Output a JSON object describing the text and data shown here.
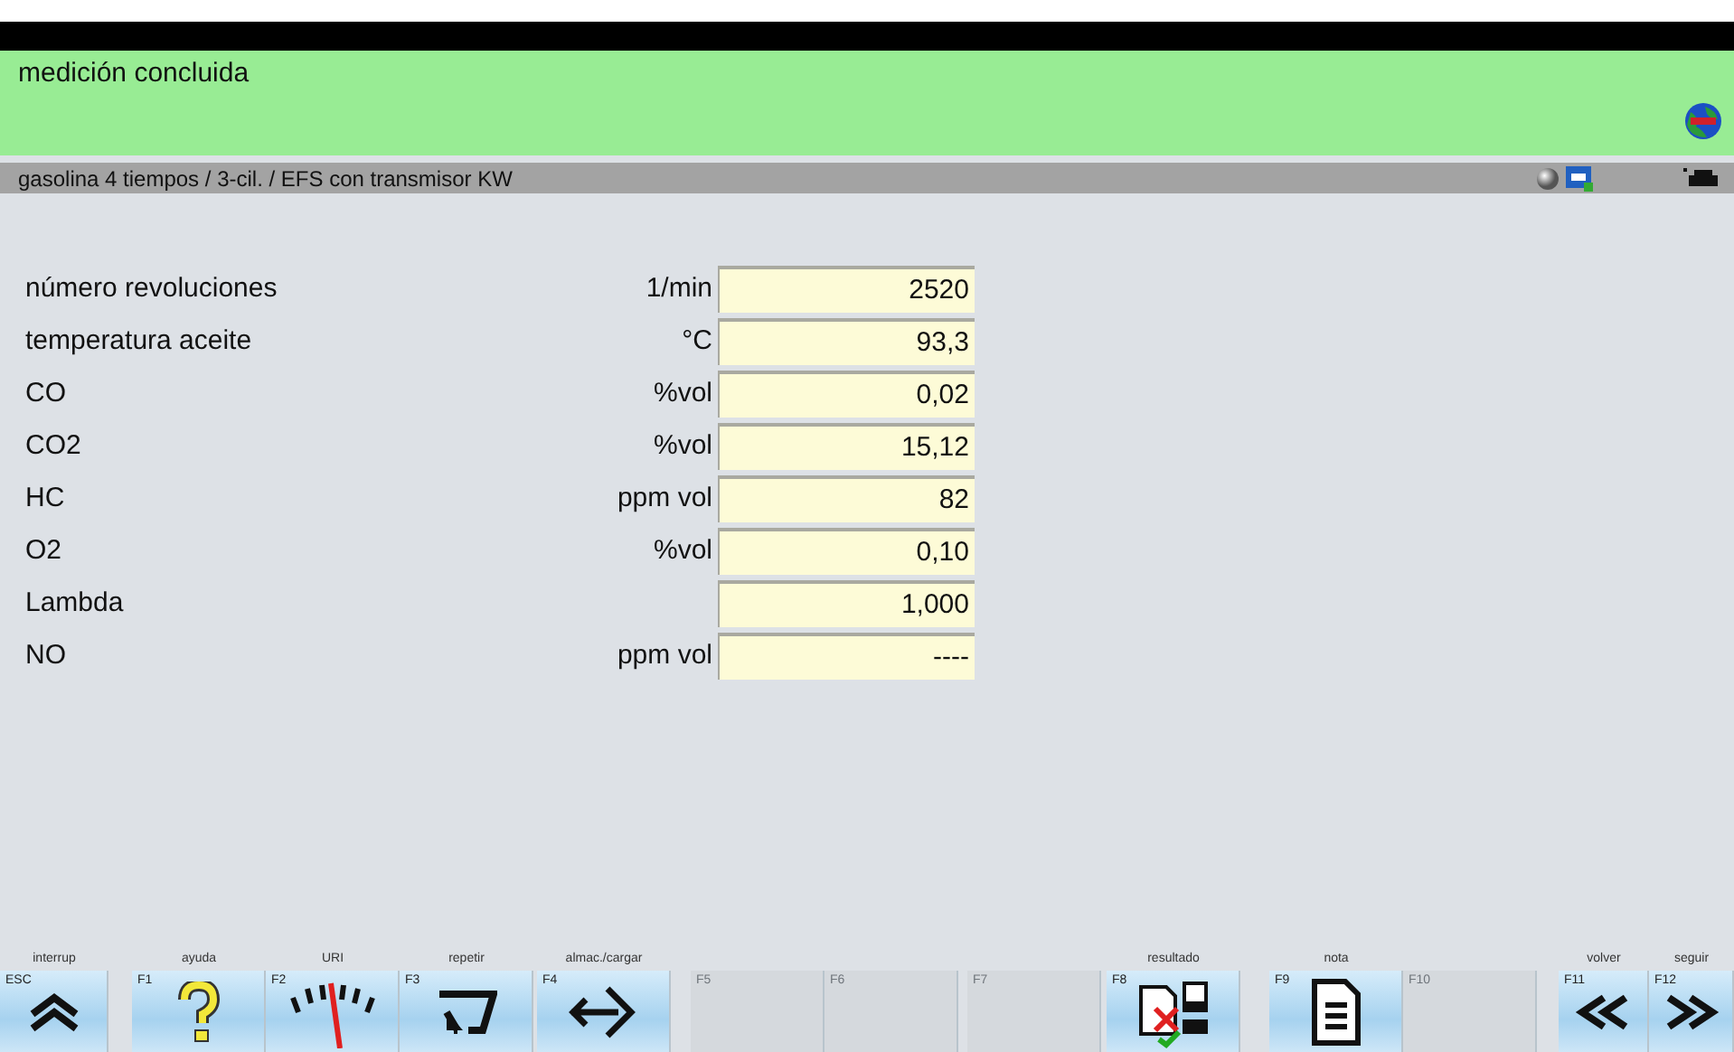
{
  "status": {
    "message": "medición concluida"
  },
  "vehicle_bar": {
    "text": "gasolina 4 tiempos /  3-cil. / EFS con transmisor KW"
  },
  "readings": [
    {
      "name": "número revoluciones",
      "unit": "1/min",
      "value": "2520"
    },
    {
      "name": "temperatura aceite",
      "unit": "°C",
      "value": "93,3"
    },
    {
      "name": "CO",
      "unit": "%vol",
      "value": "0,02"
    },
    {
      "name": "CO2",
      "unit": "%vol",
      "value": "15,12"
    },
    {
      "name": "HC",
      "unit": "ppm vol",
      "value": "82"
    },
    {
      "name": "O2",
      "unit": "%vol",
      "value": "0,10"
    },
    {
      "name": "Lambda",
      "value": "1,000"
    },
    {
      "name": "NO",
      "unit": "ppm vol",
      "value": "----"
    }
  ],
  "function_keys": [
    {
      "caption": "interrup",
      "key": "ESC",
      "disabled": false
    },
    {
      "caption": "ayuda",
      "key": "F1",
      "disabled": false
    },
    {
      "caption": "URI",
      "key": "F2",
      "disabled": false
    },
    {
      "caption": "repetir",
      "key": "F3",
      "disabled": false
    },
    {
      "caption": "almac./cargar",
      "key": "F4",
      "disabled": false
    },
    {
      "key": "F5",
      "disabled": true
    },
    {
      "key": "F6",
      "disabled": true
    },
    {
      "key": "F7",
      "disabled": true
    },
    {
      "caption": "resultado",
      "key": "F8",
      "disabled": false
    },
    {
      "caption": "nota",
      "key": "F9",
      "disabled": false
    },
    {
      "key": "F10",
      "disabled": true
    },
    {
      "caption": "volver",
      "key": "F11",
      "disabled": false
    },
    {
      "caption": "seguir",
      "key": "F12",
      "disabled": false
    }
  ]
}
